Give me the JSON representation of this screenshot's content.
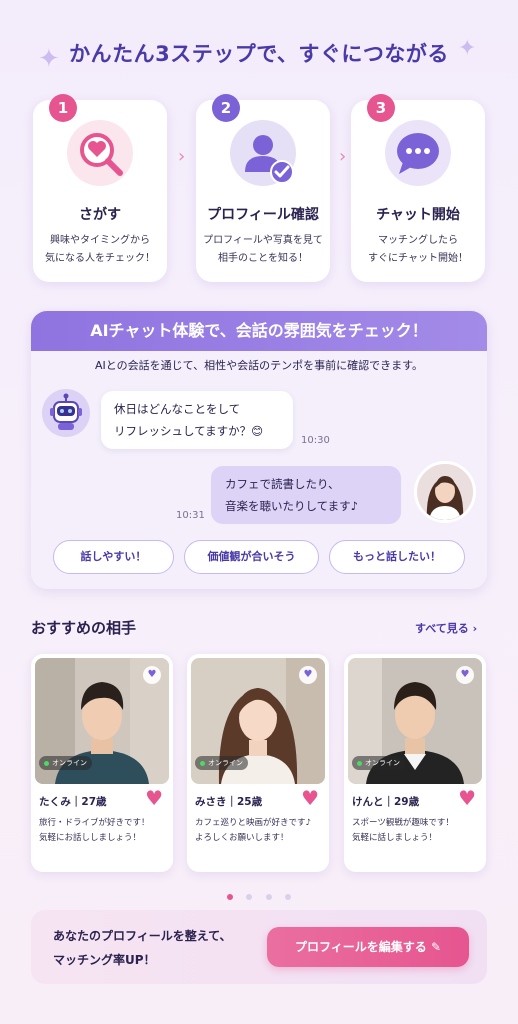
{
  "header": {
    "title": "かんたん3ステップで、すぐにつながる"
  },
  "steps": [
    {
      "num": "1",
      "title": "さがす",
      "desc1": "興味やタイミングから",
      "desc2": "気になる人をチェック！",
      "icon": "search-heart-icon"
    },
    {
      "num": "2",
      "title": "プロフィール確認",
      "desc1": "プロフィールや写真を見て",
      "desc2": "相手のことを知る！",
      "icon": "profile-check-icon"
    },
    {
      "num": "3",
      "title": "チャット開始",
      "desc1": "マッチングしたら",
      "desc2": "すぐにチャット開始！",
      "icon": "chat-bubble-icon"
    }
  ],
  "ai_chat": {
    "banner": "AIチャット体験で、会話の雰囲気をチェック！",
    "subtitle": "AIとの会話を通じて、相性や会話のテンポを事前に確認できます。",
    "bot_message_line1": "休日はどんなことをして",
    "bot_message_line2": "リフレッシュしてますか？😊",
    "bot_time": "10:30",
    "user_message_line1": "カフェで読書したり、",
    "user_message_line2": "音楽を聴いたりしてます♪",
    "user_time": "10:31",
    "replies": [
      "話しやすい！",
      "価値観が合いそう",
      "もっと話したい！"
    ]
  },
  "recommended": {
    "title": "おすすめの相手",
    "see_all": "すべて見る ›",
    "cards": [
      {
        "name": "たくみ｜27歳",
        "badge": "オンライン",
        "desc1": "旅行・ドライブが好きです！",
        "desc2": "気軽にお話ししましょう！"
      },
      {
        "name": "みさき｜25歳",
        "badge": "オンライン",
        "desc1": "カフェ巡りと映画が好きです♪",
        "desc2": "よろしくお願いします！"
      },
      {
        "name": "けんと｜29歳",
        "badge": "オンライン",
        "desc1": "スポーツ観戦が趣味です！",
        "desc2": "気軽に話しましょう！"
      }
    ]
  },
  "cta": {
    "line1": "あなたのプロフィールを整えて、",
    "line2": "マッチング率UP！",
    "button": "プロフィールを編集する ✎"
  },
  "colors": {
    "accent_pink": "#e6558f",
    "accent_purple": "#7b62d6",
    "title": "#4a3aa8"
  }
}
